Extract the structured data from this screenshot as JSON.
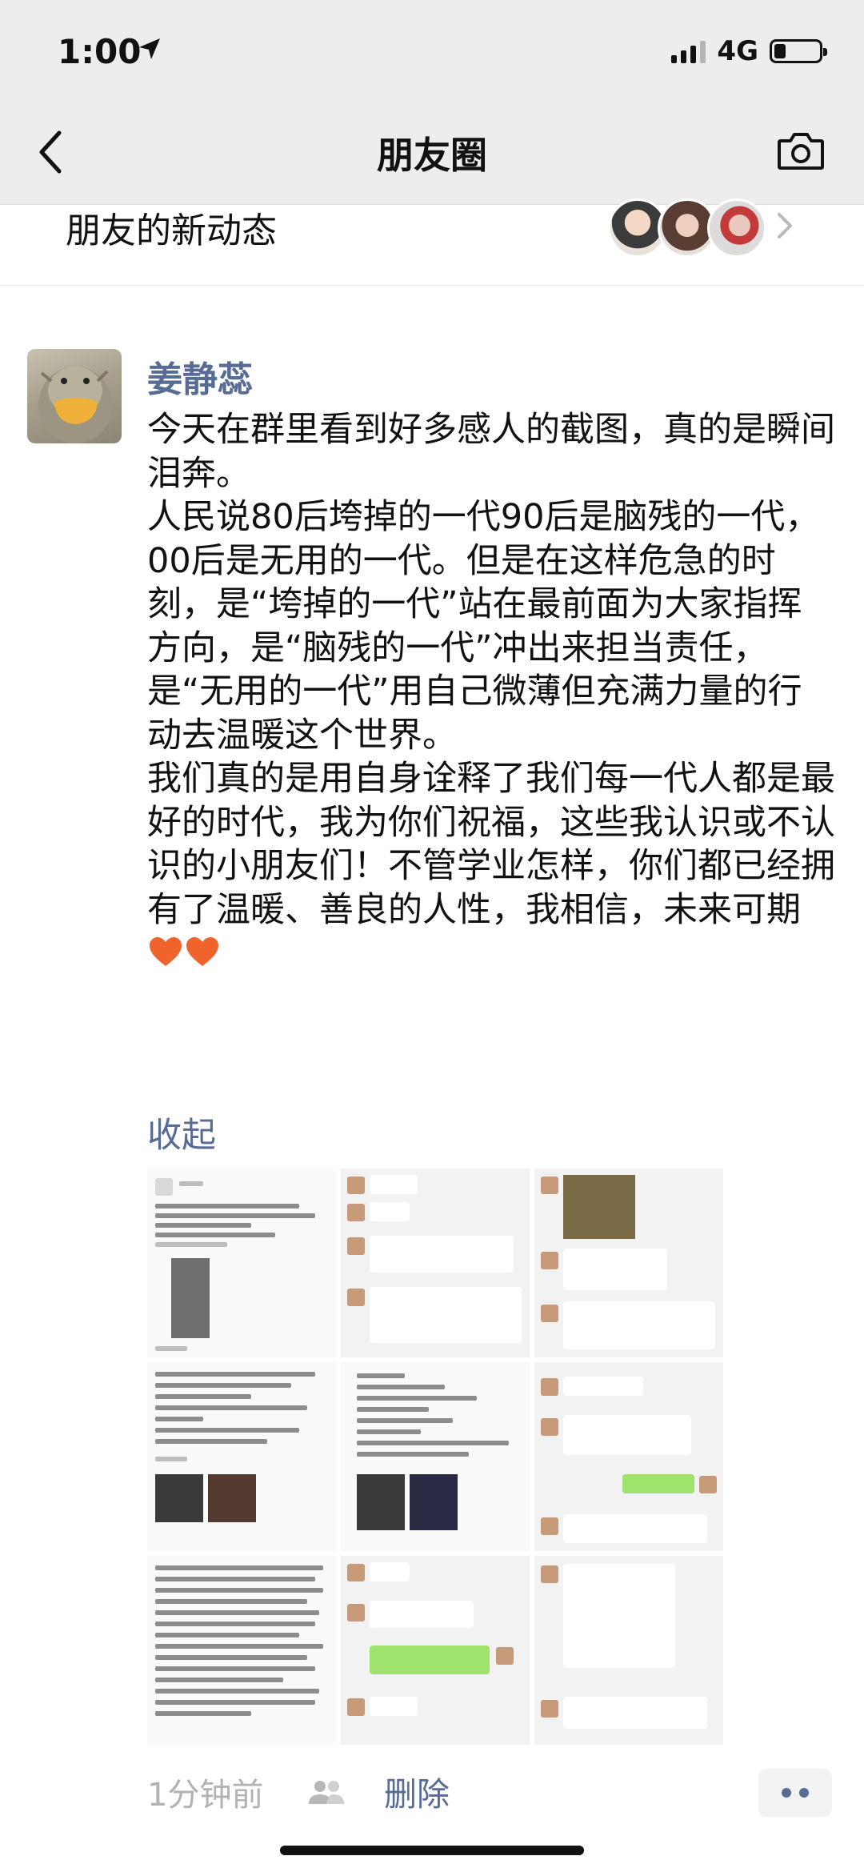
{
  "status_bar": {
    "time": "1:00",
    "network": "4G"
  },
  "nav": {
    "title": "朋友圈"
  },
  "friends_updates": {
    "label": "朋友的新动态"
  },
  "post": {
    "author": "姜静蕊",
    "text": "今天在群里看到好多感人的截图，真的是瞬间泪奔。\n人民说80后垮掉的一代90后是脑残的一代，00后是无用的一代。但是在这样危急的时刻，是“垮掉的一代”站在最前面为大家指挥方向，是“脑残的一代”冲出来担当责任，是“无用的一代”用自己微薄但充满力量的行动去温暖这个世界。\n我们真的是用自身诠释了我们每一代人都是最好的时代，我为你们祝福，这些我认识或不认识的小朋友们！不管学业怎样，你们都已经拥有了温暖、善良的人性，我相信，未来可期",
    "collapse_label": "收起",
    "time_ago": "1分钟前",
    "delete_label": "删除",
    "accent_link_color": "#576b95"
  }
}
